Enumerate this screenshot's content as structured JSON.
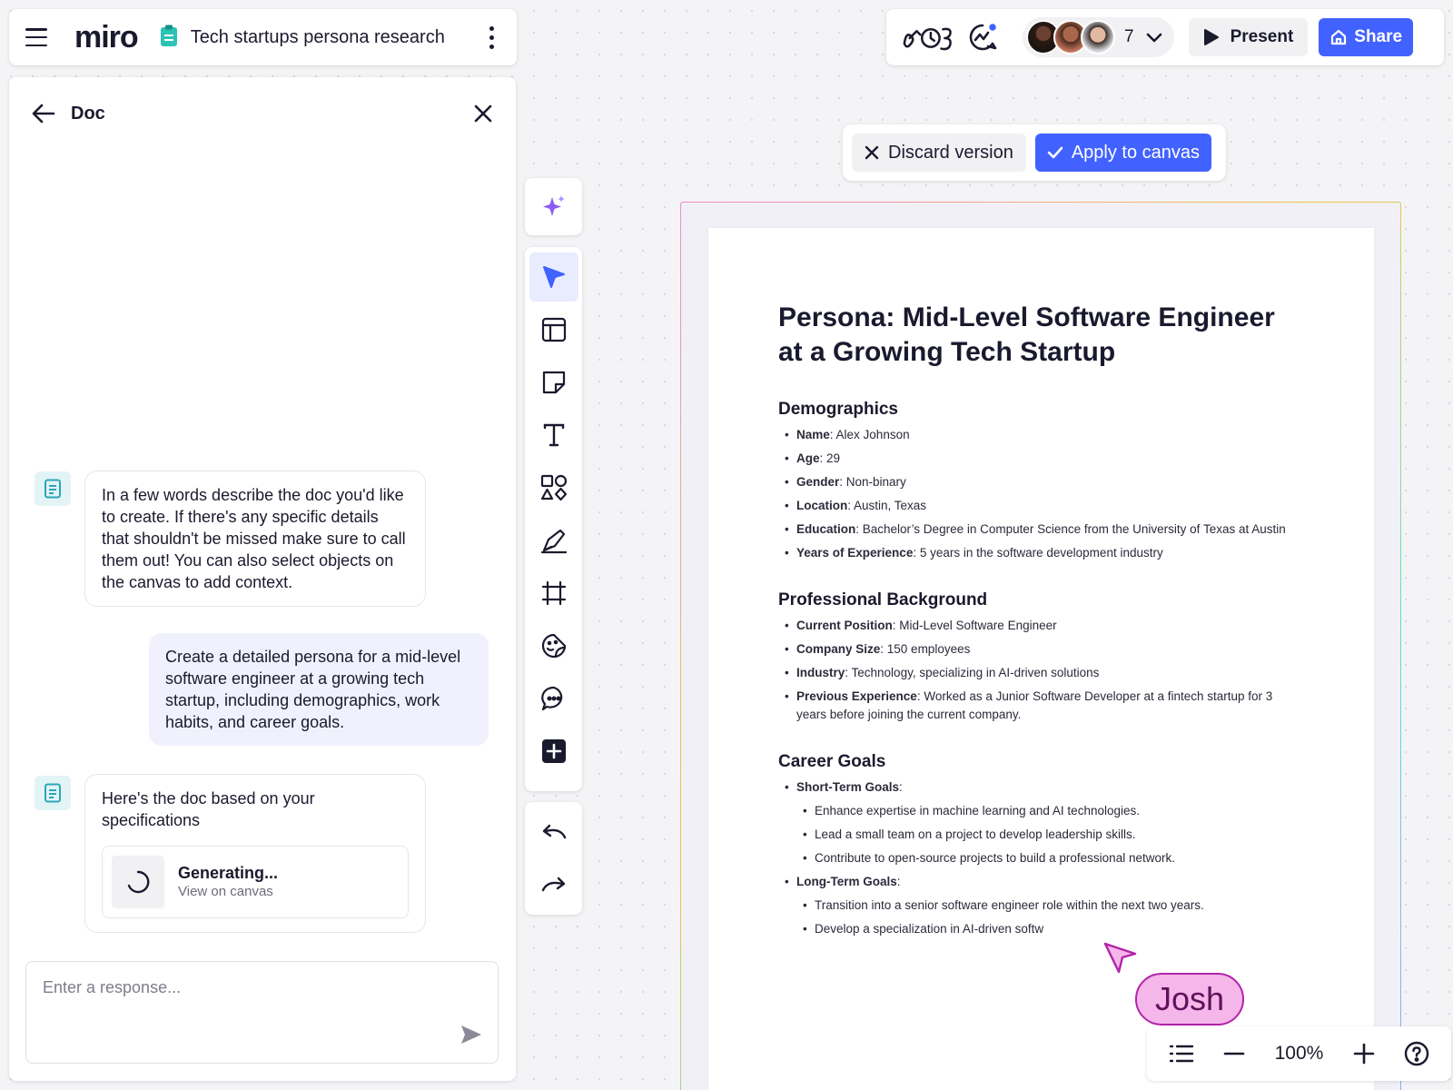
{
  "topbar": {
    "logo": "miro",
    "board_title": "Tech startups persona research"
  },
  "collab": {
    "participant_count": "7",
    "present_label": "Present",
    "share_label": "Share",
    "accent": "#4262ff"
  },
  "doc_panel": {
    "title": "Doc",
    "messages": [
      {
        "role": "assistant",
        "text": "In a few words describe the doc you'd like to create. If there's any specific details that shouldn't be missed make sure to call them out! You can also select objects on the canvas to add context."
      },
      {
        "role": "user",
        "text": "Create a detailed persona for a mid-level software engineer at a growing tech startup, including demographics, work habits, and career goals."
      },
      {
        "role": "assistant",
        "text": "Here's the doc based on your specifications"
      }
    ],
    "generating": {
      "title": "Generating...",
      "link": "View on canvas"
    },
    "input_placeholder": "Enter a response..."
  },
  "version_bar": {
    "discard_label": "Discard version",
    "apply_label": "Apply to canvas"
  },
  "document": {
    "title": "Persona: Mid-Level Software Engineer at a Growing Tech Startup",
    "sections": [
      {
        "heading": "Demographics",
        "items": [
          {
            "label": "Name",
            "value": ": Alex Johnson"
          },
          {
            "label": "Age",
            "value": ": 29"
          },
          {
            "label": "Gender",
            "value": ": Non-binary"
          },
          {
            "label": "Location",
            "value": ": Austin, Texas"
          },
          {
            "label": "Education",
            "value": ": Bachelor’s Degree in Computer Science from the University of Texas at Austin"
          },
          {
            "label": "Years of Experience",
            "value": ": 5 years in the software development industry"
          }
        ]
      },
      {
        "heading": "Professional Background",
        "items": [
          {
            "label": "Current Position",
            "value": ": Mid-Level Software Engineer"
          },
          {
            "label": "Company Size",
            "value": ": 150 employees"
          },
          {
            "label": "Industry",
            "value": ": Technology, specializing in AI-driven solutions"
          },
          {
            "label": "Previous Experience",
            "value": ": Worked as a Junior Software Developer at a fintech startup for 3 years before joining the current company."
          }
        ]
      },
      {
        "heading": "Career Goals",
        "items": [
          {
            "label": "Short-Term Goals",
            "value": ":"
          },
          {
            "sub": "Enhance expertise in machine learning and AI technologies."
          },
          {
            "sub": "Lead a small team on a project to develop leadership skills."
          },
          {
            "sub": "Contribute to open-source projects to build a professional network."
          },
          {
            "label": "Long-Term Goals",
            "value": ":"
          },
          {
            "sub": "Transition into a senior software engineer role within the next two years."
          },
          {
            "sub": "Develop a specialization in AI-driven softw"
          }
        ]
      }
    ]
  },
  "cursor": {
    "user_name": "Josh",
    "color": "#f5b6e9"
  },
  "zoom": {
    "level": "100%"
  }
}
